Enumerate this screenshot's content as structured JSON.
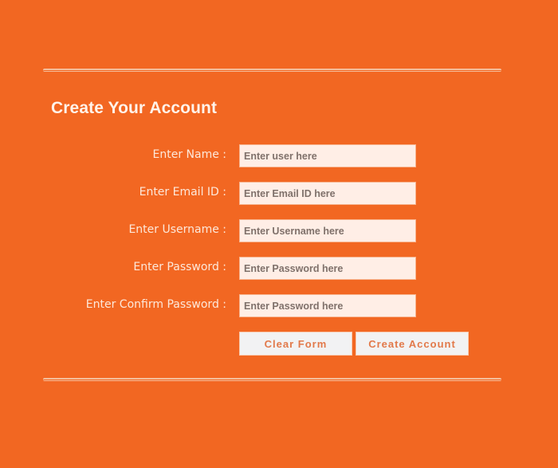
{
  "form": {
    "title": "Create Your Account",
    "fields": [
      {
        "label": "Enter Name :",
        "placeholder": "Enter user here",
        "value": ""
      },
      {
        "label": "Enter Email ID :",
        "placeholder": "Enter Email ID here",
        "value": ""
      },
      {
        "label": "Enter Username :",
        "placeholder": "Enter Username here",
        "value": ""
      },
      {
        "label": "Enter Password :",
        "placeholder": "Enter Password here",
        "value": ""
      },
      {
        "label": "Enter Confirm Password :",
        "placeholder": "Enter Password here",
        "value": ""
      }
    ],
    "buttons": {
      "clear_label": "Clear Form",
      "create_label": "Create Account"
    }
  },
  "colors": {
    "background": "#f26722",
    "input_background": "#ffeee6",
    "button_background": "#f2f2f3",
    "button_text": "#e2794a"
  }
}
